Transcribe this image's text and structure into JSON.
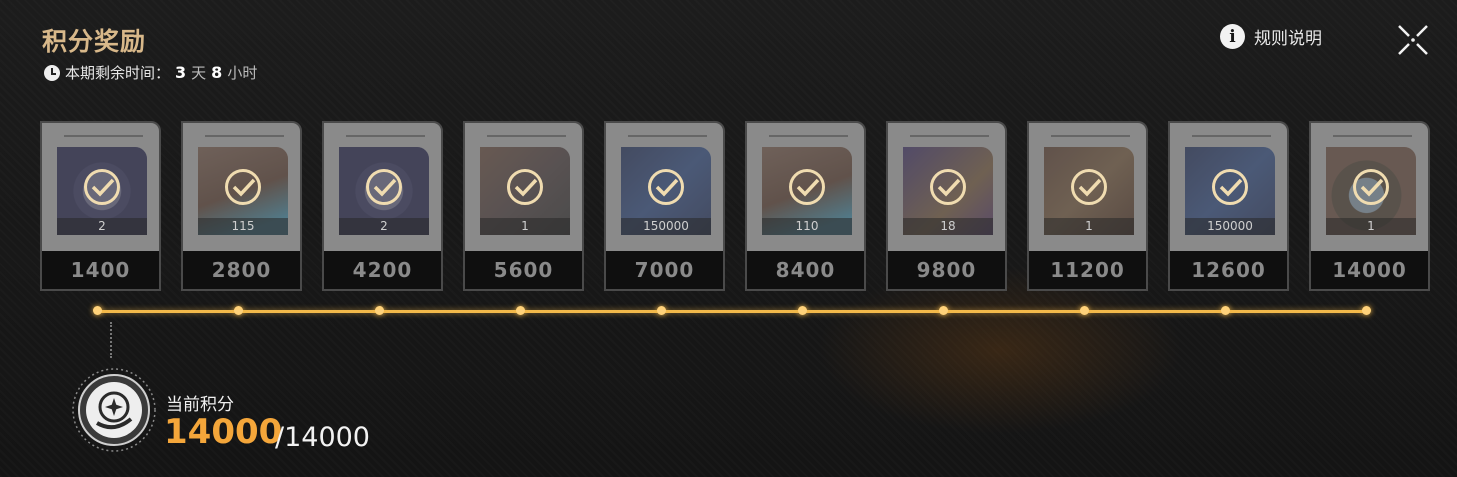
{
  "header": {
    "title": "积分奖励",
    "timer_prefix": "本期剩余时间：",
    "days": "3",
    "day_unit": "天",
    "hours": "8",
    "hour_unit": "小时",
    "rules_label": "规则说明"
  },
  "rewards": [
    {
      "score": "1400",
      "qty": "2",
      "item": "medal",
      "claimed": true
    },
    {
      "score": "2800",
      "qty": "115",
      "item": "crystal-rock",
      "claimed": true
    },
    {
      "score": "4200",
      "qty": "2",
      "item": "medal",
      "claimed": true
    },
    {
      "score": "5600",
      "qty": "1",
      "item": "chip",
      "claimed": true
    },
    {
      "score": "7000",
      "qty": "150000",
      "item": "credit-card",
      "claimed": true
    },
    {
      "score": "8400",
      "qty": "110",
      "item": "crystal-rock",
      "claimed": true
    },
    {
      "score": "9800",
      "qty": "18",
      "item": "gold-fragment",
      "claimed": true
    },
    {
      "score": "11200",
      "qty": "1",
      "item": "data-module",
      "claimed": true
    },
    {
      "score": "12600",
      "qty": "150000",
      "item": "credit-card",
      "claimed": true
    },
    {
      "score": "14000",
      "qty": "1",
      "item": "orb",
      "claimed": true
    }
  ],
  "progress": {
    "label": "当前积分",
    "current": "14000",
    "total": "/14000",
    "fraction": 1.0
  },
  "colors": {
    "accent": "#f3b94a",
    "current_score": "#f4a63a",
    "title": "#d8b88a"
  }
}
